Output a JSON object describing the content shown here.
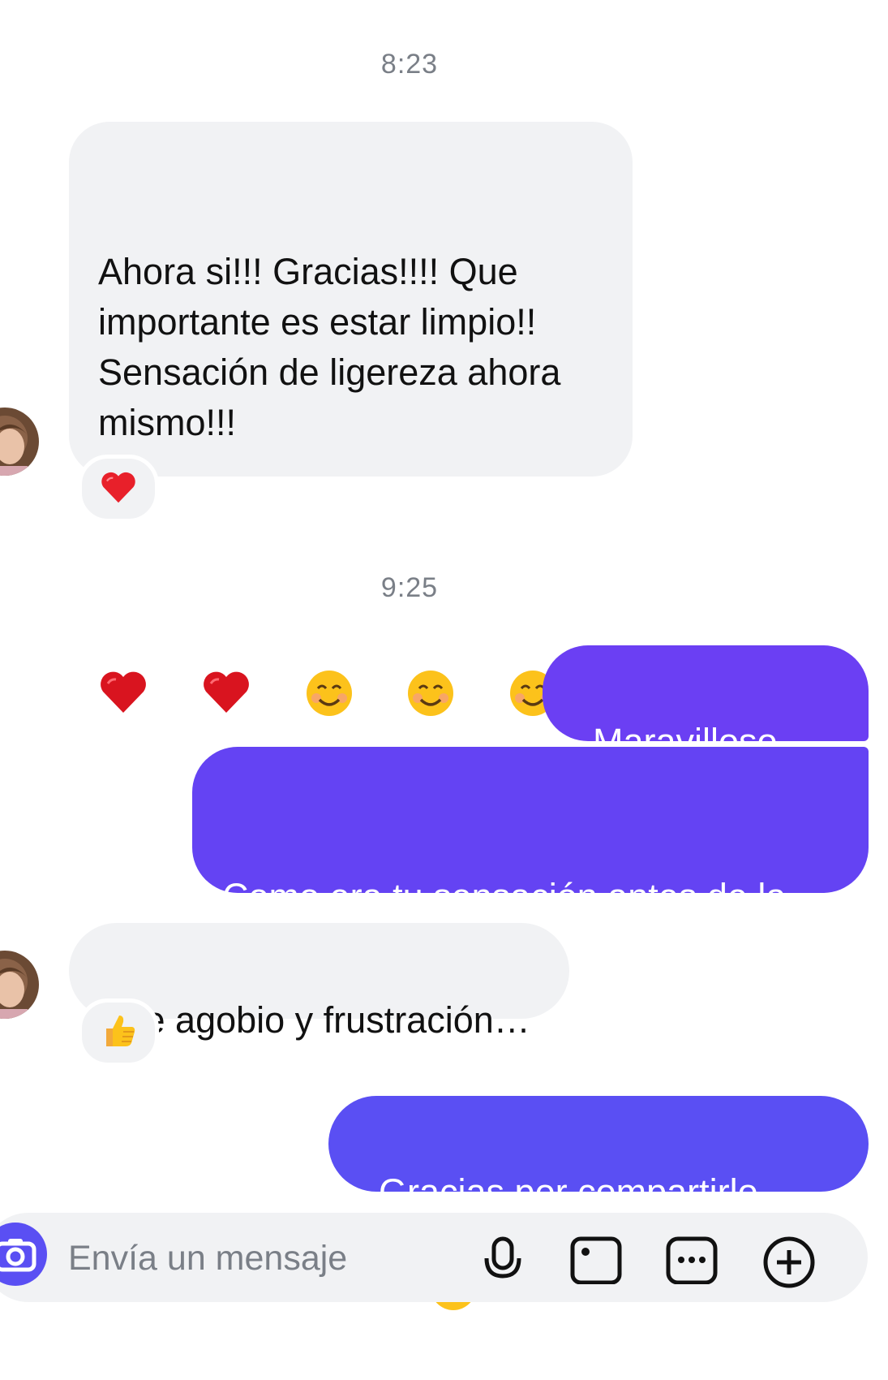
{
  "thread": {
    "timestamps": [
      "8:23",
      "9:25"
    ],
    "messages": [
      {
        "text": "Ahora si!!! Gracias!!!! Que\nimportante es estar limpio!!\nSensación de ligereza ahora\nmismo!!!",
        "reaction": "heart"
      },
      {
        "text": "Maravilloso"
      },
      {
        "text": "Como era tu sensación antes de la\nlimpieza?"
      },
      {
        "text": "De agobio y frustración…",
        "reaction": "thumbs-up"
      },
      {
        "text": "Gracias por compartirlo"
      }
    ]
  },
  "composer": {
    "placeholder": "Envía un mensaje",
    "icons": [
      "camera-icon",
      "microphone-icon",
      "image-icon",
      "sticker-icon",
      "add-icon"
    ]
  },
  "colors": {
    "incoming_bubble": "#f1f2f4",
    "outgoing_top": "#6b3ff3",
    "outgoing_bottom": "#5a4ff3",
    "timestamp": "#7a7f87"
  }
}
